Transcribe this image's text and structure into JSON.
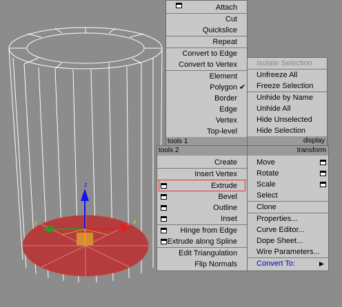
{
  "colors": {
    "viewport_bg": "#8c8c8c",
    "menu_bg": "#c8c8c8",
    "header_bg": "#9a9a9a",
    "highlight_border": "#e03030",
    "link_blue": "#0000cc"
  },
  "top_left": {
    "items": [
      "Attach",
      "Cut",
      "Quickslice",
      "Repeat",
      "Convert to Edge",
      "Convert to Vertex",
      "Element",
      "Polygon",
      "Border",
      "Edge",
      "Vertex",
      "Top-level"
    ],
    "checked": "Polygon",
    "footer": "tools 1"
  },
  "top_right": {
    "items": [
      "Isolate Selection",
      "Unfreeze All",
      "Freeze Selection",
      "Unhide by Name",
      "Unhide All",
      "Hide Unselected",
      "Hide Selection"
    ],
    "disabled": "Isolate Selection",
    "footer": "display"
  },
  "bottom_left": {
    "header": "tools 2",
    "items": [
      "Create",
      "Insert Vertex",
      "Extrude",
      "Bevel",
      "Outline",
      "Inset",
      "Hinge from Edge",
      "Extrude along Spline",
      "Edit Triangulation",
      "Flip Normals"
    ],
    "highlighted": "Extrude"
  },
  "bottom_right": {
    "header": "transform",
    "items": [
      "Move",
      "Rotate",
      "Scale",
      "Select",
      "Clone",
      "Properties...",
      "Curve Editor...",
      "Dope Sheet...",
      "Wire Parameters...",
      "Convert To:"
    ],
    "submenu": "Convert To:"
  },
  "gizmo": {
    "x_label": "x",
    "y_label": "y",
    "z_label": "z"
  }
}
